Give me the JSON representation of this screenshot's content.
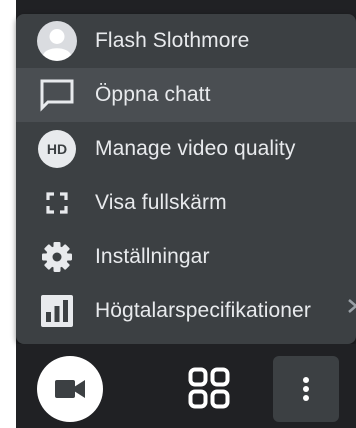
{
  "menu": {
    "items": [
      {
        "label": "Flash Slothmore",
        "icon": "avatar-icon"
      },
      {
        "label": "Öppna chatt",
        "icon": "chat-icon"
      },
      {
        "label": "Manage video quality",
        "icon": "hd-icon",
        "icon_text": "HD"
      },
      {
        "label": "Visa fullskärm",
        "icon": "fullscreen-icon"
      },
      {
        "label": "Inställningar",
        "icon": "gear-icon"
      },
      {
        "label": "Högtalarspecifikationer",
        "icon": "bar-chart-icon"
      }
    ]
  },
  "toolbar": {
    "camera_icon": "video-camera-icon",
    "layout_icon": "grid-layout-icon",
    "more_icon": "more-vertical-icon"
  },
  "colors": {
    "menu_bg": "#3c4043",
    "menu_hover": "#4a4e52",
    "text": "#e8eaed",
    "call_bg": "#202124",
    "button_bg": "#3c4043"
  }
}
